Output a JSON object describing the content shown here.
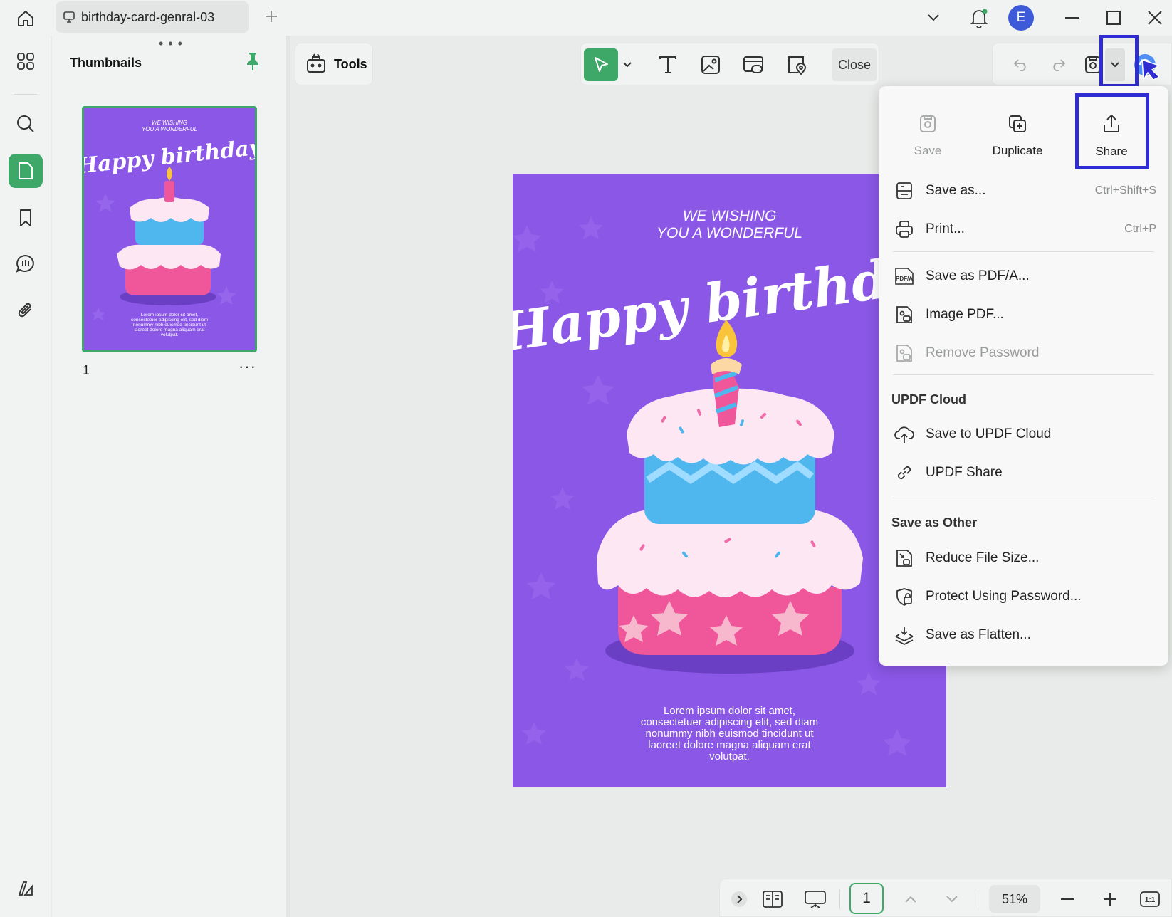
{
  "tab": {
    "title": "birthday-card-genral-03"
  },
  "avatar": {
    "initial": "E"
  },
  "thumbnails": {
    "title": "Thumbnails",
    "page_number": "1",
    "more": "···"
  },
  "toolbar": {
    "tools_label": "Tools",
    "close_label": "Close"
  },
  "document": {
    "top_line1": "WE WISHING",
    "top_line2": "YOU A WONDERFUL",
    "headline": "Happy birthday",
    "body_lines": [
      "Lorem ipsum dolor sit amet,",
      "consectetuer adipiscing elit, sed diam",
      "nonummy nibh euismod tincidunt ut",
      "laoreet dolore magna aliquam erat",
      "volutpat."
    ]
  },
  "menu": {
    "top": {
      "save": "Save",
      "duplicate": "Duplicate",
      "share": "Share"
    },
    "save_as": {
      "label": "Save as...",
      "shortcut": "Ctrl+Shift+S"
    },
    "print": {
      "label": "Print...",
      "shortcut": "Ctrl+P"
    },
    "save_pdfa": "Save as PDF/A...",
    "image_pdf": "Image PDF...",
    "remove_password": "Remove Password",
    "cloud_header": "UPDF Cloud",
    "save_cloud": "Save to UPDF Cloud",
    "updf_share": "UPDF Share",
    "other_header": "Save as Other",
    "reduce": "Reduce File Size...",
    "protect": "Protect Using Password...",
    "flatten": "Save as Flatten..."
  },
  "bottombar": {
    "page": "1",
    "zoom": "51%",
    "fit_label": "1:1"
  },
  "colors": {
    "accent": "#3ea868",
    "highlight": "#2f2dd1",
    "page_bg": "#8a57e6"
  }
}
